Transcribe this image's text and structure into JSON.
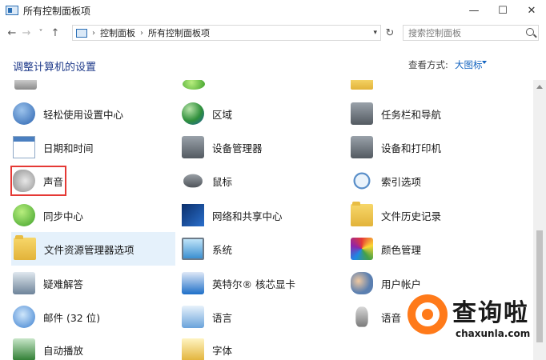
{
  "window": {
    "title": "所有控制面板项",
    "minimize": "—",
    "maximize": "☐",
    "close": "✕"
  },
  "nav": {
    "back": "←",
    "forward": "→",
    "recent": "˅",
    "up": "↑",
    "breadcrumb": [
      "控制面板",
      "所有控制面板项"
    ],
    "breadcrumb_sep": "›",
    "refresh": "↻",
    "search_placeholder": "搜索控制面板"
  },
  "header": {
    "heading": "调整计算机的设置",
    "view_by_label": "查看方式:",
    "view_by_value": "大图标"
  },
  "items": [
    {
      "label": "轻松使用设置中心",
      "icon": "ease-of-access-icon"
    },
    {
      "label": "区域",
      "icon": "region-globe-icon"
    },
    {
      "label": "任务栏和导航",
      "icon": "taskbar-icon"
    },
    {
      "label": "日期和时间",
      "icon": "calendar-clock-icon"
    },
    {
      "label": "设备管理器",
      "icon": "device-manager-icon"
    },
    {
      "label": "设备和打印机",
      "icon": "printer-icon"
    },
    {
      "label": "声音",
      "icon": "speaker-icon"
    },
    {
      "label": "鼠标",
      "icon": "mouse-icon"
    },
    {
      "label": "索引选项",
      "icon": "indexing-icon"
    },
    {
      "label": "同步中心",
      "icon": "sync-icon"
    },
    {
      "label": "网络和共享中心",
      "icon": "network-icon"
    },
    {
      "label": "文件历史记录",
      "icon": "file-history-icon"
    },
    {
      "label": "文件资源管理器选项",
      "icon": "folder-options-icon"
    },
    {
      "label": "系统",
      "icon": "system-icon"
    },
    {
      "label": "颜色管理",
      "icon": "color-management-icon"
    },
    {
      "label": "疑难解答",
      "icon": "troubleshooting-icon"
    },
    {
      "label": "英特尔® 核芯显卡",
      "icon": "intel-graphics-icon"
    },
    {
      "label": "用户帐户",
      "icon": "user-accounts-icon"
    },
    {
      "label": "邮件 (32 位)",
      "icon": "mail-icon"
    },
    {
      "label": "语言",
      "icon": "language-icon"
    },
    {
      "label": "语音",
      "icon": "speech-icon"
    },
    {
      "label": "自动播放",
      "icon": "autoplay-icon"
    },
    {
      "label": "字体",
      "icon": "fonts-icon"
    }
  ],
  "watermark": {
    "text": "查询啦",
    "sub": "chaxunla.com"
  },
  "colors": {
    "heading": "#1e3a8a",
    "link": "#1565c0",
    "highlight_box": "#e53935",
    "selected_bg": "#e5f1fb"
  }
}
